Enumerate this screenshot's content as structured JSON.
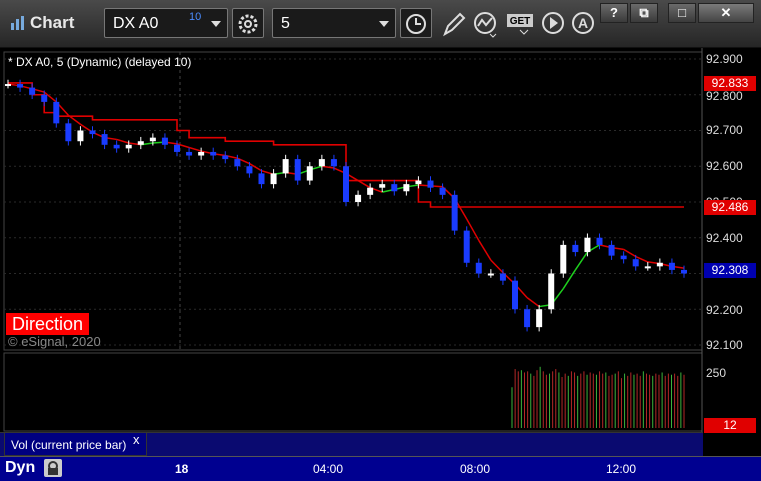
{
  "app": {
    "title": "Chart"
  },
  "toolbar": {
    "symbol": "DX A0",
    "symbol_superscript": "10",
    "interval": "5",
    "icons": [
      "settings-gear-icon",
      "clock-icon",
      "pencil-draw-icon",
      "study-indicator-icon",
      "get-data-icon",
      "play-icon",
      "auto-scale-icon"
    ],
    "get_label": "GET",
    "auto_label": "A",
    "window_buttons": [
      "?",
      "⧉",
      "□",
      "✕"
    ]
  },
  "chart": {
    "study_label": "* DX A0, 5 (Dynamic) (delayed 10)",
    "direction_label": "Direction",
    "copyright": "© eSignal, 2020",
    "price_axis": [
      "92.900",
      "92.800",
      "92.700",
      "92.600",
      "92.500",
      "92.400",
      "92.300",
      "92.200",
      "92.100"
    ],
    "price_tags": [
      {
        "value": "92.833",
        "color": "#e00000"
      },
      {
        "value": "92.486",
        "color": "#e00000"
      },
      {
        "value": "92.308",
        "color": "#0000b0"
      }
    ],
    "volume_axis": [
      "250"
    ],
    "volume_tag": {
      "value": "12",
      "color": "#e00000"
    },
    "volume_label": "Vol (current price bar)",
    "volume_close": "x",
    "time_axis": [
      "18",
      "04:00",
      "08:00",
      "12:00"
    ],
    "bottom_label": "Dyn",
    "colors": {
      "stop_line": "#e00000",
      "up_bar": "#ffffff",
      "down_bar": "#1a3cff",
      "ma_green": "#1ed01e",
      "ma_red": "#e00000",
      "grid": "#2a2a2a",
      "vol_up": "#3cb43c",
      "vol_down": "#b42828"
    }
  },
  "chart_data": {
    "type": "line",
    "title": "DX A0, 5 (Dynamic) (delayed 10)",
    "ylim": [
      92.1,
      92.9
    ],
    "x_ticks": [
      "18",
      "04:00",
      "08:00",
      "12:00"
    ],
    "y_ticks": [
      92.9,
      92.8,
      92.7,
      92.6,
      92.5,
      92.4,
      92.3,
      92.2,
      92.1
    ],
    "series": [
      {
        "name": "price",
        "values": [
          92.83,
          92.82,
          92.8,
          92.78,
          92.72,
          92.67,
          92.7,
          92.69,
          92.66,
          92.65,
          92.66,
          92.67,
          92.68,
          92.66,
          92.64,
          92.63,
          92.64,
          92.63,
          92.62,
          92.6,
          92.58,
          92.55,
          92.58,
          92.62,
          92.56,
          92.6,
          92.62,
          92.6,
          92.5,
          92.52,
          92.54,
          92.55,
          92.53,
          92.55,
          92.56,
          92.54,
          92.52,
          92.42,
          92.33,
          92.3,
          92.3,
          92.28,
          92.2,
          92.15,
          92.2,
          92.3,
          92.38,
          92.36,
          92.4,
          92.38,
          92.35,
          92.34,
          92.32,
          92.32,
          92.33,
          92.31,
          92.3
        ]
      },
      {
        "name": "stop",
        "values": [
          92.833,
          92.833,
          92.8,
          92.75,
          92.74,
          92.74,
          92.74,
          92.73,
          92.73,
          92.73,
          92.73,
          92.73,
          92.73,
          92.73,
          92.7,
          92.68,
          92.68,
          92.68,
          92.67,
          92.67,
          92.67,
          92.67,
          92.66,
          92.66,
          92.66,
          92.66,
          92.66,
          92.66,
          92.56,
          92.56,
          92.56,
          92.56,
          92.56,
          92.56,
          92.5,
          92.486,
          92.486,
          92.486,
          92.486,
          92.486,
          92.486,
          92.486,
          92.486,
          92.486,
          92.486,
          92.486,
          92.486,
          92.486,
          92.486,
          92.486,
          92.486,
          92.486,
          92.486,
          92.486,
          92.486,
          92.486,
          92.486
        ]
      }
    ],
    "volume": {
      "ylim": [
        0,
        300
      ],
      "last": 12
    }
  }
}
